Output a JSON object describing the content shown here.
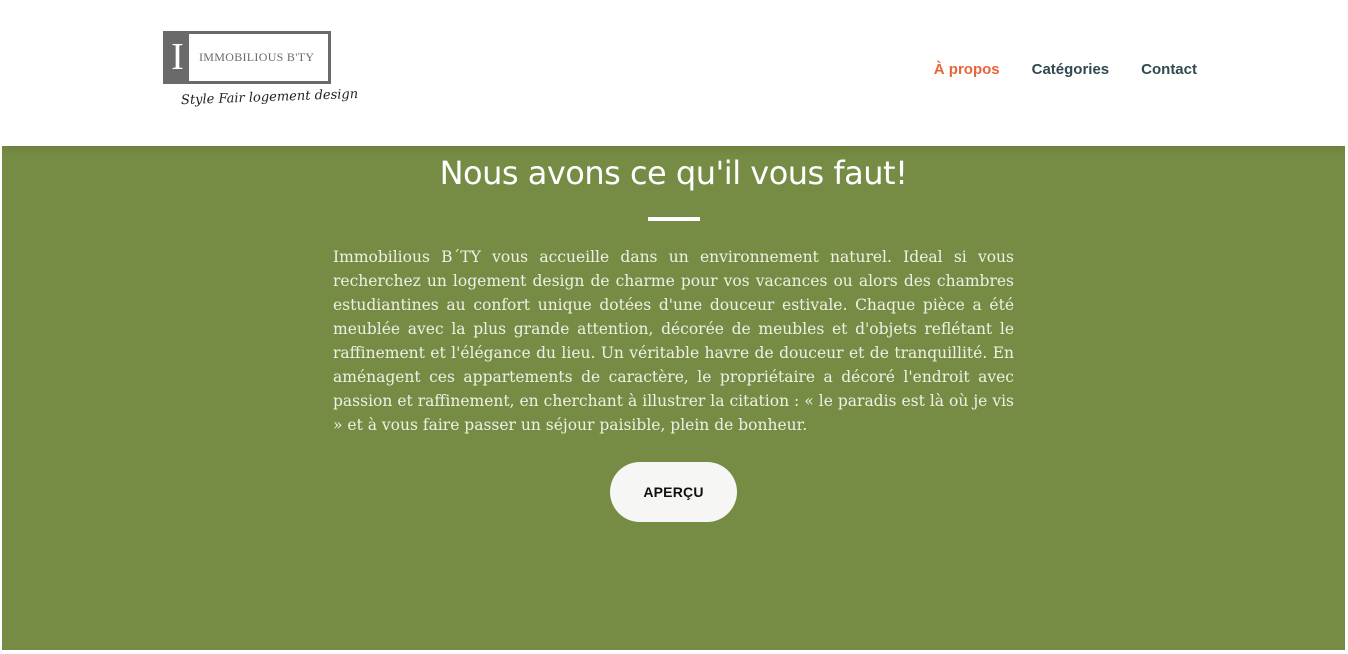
{
  "header": {
    "logo": {
      "initial": "I",
      "name": "IMMOBILIOUS B'TY",
      "tagline": "Style Fair logement design"
    },
    "nav": [
      {
        "label": "À propos",
        "active": true
      },
      {
        "label": "Catégories",
        "active": false
      },
      {
        "label": "Contact",
        "active": false
      }
    ]
  },
  "hero": {
    "title": "Nous avons ce qu'il vous faut!",
    "text": "Immobilious B´TY vous accueille dans un environnement naturel. Ideal si vous recherchez un logement design de charme pour vos vacances ou alors des chambres estudiantines au confort unique dotées d'une douceur estivale. Chaque pièce a été meublée avec la plus grande attention, décorée de meubles et d'objets reflétant le raffinement et l'élégance du lieu. Un véritable havre de douceur et de tranquillité. En aménagent ces appartements de caractère, le propriétaire a décoré l'endroit avec passion et raffinement, en cherchant à illustrer la citation : « le paradis est là où je vis » et à vous faire passer un séjour paisible, plein de bonheur.",
    "button_label": "APERÇU"
  },
  "colors": {
    "hero_background": "#768c44",
    "nav_active": "#e8643a",
    "nav_default": "#2f4b50"
  }
}
